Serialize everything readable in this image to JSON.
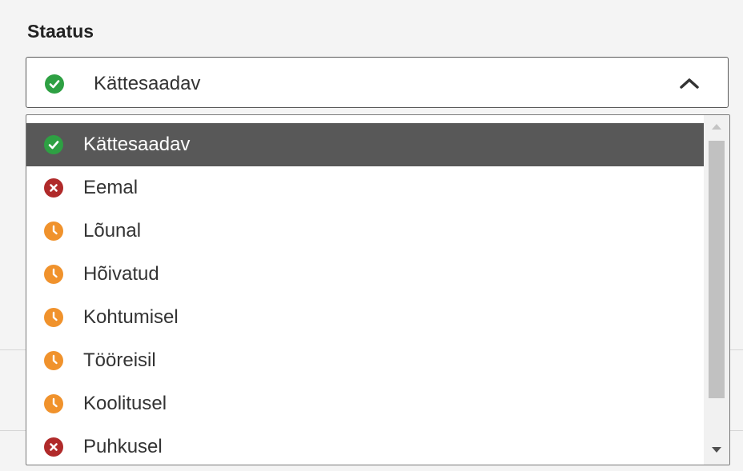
{
  "field": {
    "label": "Staatus"
  },
  "select": {
    "value": "Kättesaadav",
    "value_icon": "check-circle-icon",
    "expanded": true
  },
  "options": [
    {
      "label": "Kättesaadav",
      "icon": "check-circle-icon",
      "color": "#2ea043",
      "selected": true
    },
    {
      "label": "Eemal",
      "icon": "x-circle-icon",
      "color": "#b02a2a",
      "selected": false
    },
    {
      "label": "Lõunal",
      "icon": "clock-icon",
      "color": "#f0922c",
      "selected": false
    },
    {
      "label": "Hõivatud",
      "icon": "clock-icon",
      "color": "#f0922c",
      "selected": false
    },
    {
      "label": "Kohtumisel",
      "icon": "clock-icon",
      "color": "#f0922c",
      "selected": false
    },
    {
      "label": "Tööreisil",
      "icon": "clock-icon",
      "color": "#f0922c",
      "selected": false
    },
    {
      "label": "Koolitusel",
      "icon": "clock-icon",
      "color": "#f0922c",
      "selected": false
    },
    {
      "label": "Puhkusel",
      "icon": "x-circle-icon",
      "color": "#b02a2a",
      "selected": false
    }
  ],
  "colors": {
    "available": "#2ea043",
    "away": "#b02a2a",
    "busy": "#f0922c",
    "selected_row": "#585858"
  }
}
